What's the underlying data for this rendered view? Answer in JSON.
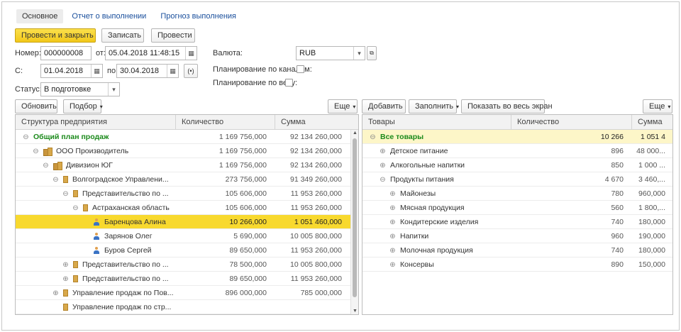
{
  "tabs": [
    {
      "label": "Основное",
      "active": true
    },
    {
      "label": "Отчет о выполнении",
      "active": false
    },
    {
      "label": "Прогноз выполнения",
      "active": false
    }
  ],
  "toolbar": {
    "post_close": "Провести и закрыть",
    "save": "Записать",
    "post": "Провести"
  },
  "form": {
    "number_label": "Номер:",
    "number_value": "000000008",
    "from_label": "от:",
    "from_value": "05.04.2018 11:48:15",
    "start_label": "С:",
    "start_value": "01.04.2018",
    "end_label": "по:",
    "end_value": "30.04.2018",
    "status_label": "Статус:",
    "status_value": "В подготовке",
    "currency_label": "Валюта:",
    "currency_value": "RUB",
    "channels_label": "Планирование по каналам:",
    "weight_label": "Планирование по весу:"
  },
  "left_toolbar": {
    "refresh": "Обновить",
    "pick": "Подбор",
    "more": "Еще"
  },
  "right_toolbar": {
    "add": "Добавить",
    "fill": "Заполнить",
    "fullscreen": "Показать во весь экран",
    "more": "Еще"
  },
  "left_table": {
    "headers": [
      "Структура предприятия",
      "Количество",
      "Сумма"
    ],
    "rows": [
      {
        "name": "Общий план продаж",
        "qty": "1 169 756,000",
        "sum": "92 134 260,000",
        "level": 0,
        "icon": "none",
        "exp": "⊖",
        "green": true
      },
      {
        "name": "ООО Производитель",
        "qty": "1 169 756,000",
        "sum": "92 134 260,000",
        "level": 1,
        "icon": "folder2",
        "exp": "⊖"
      },
      {
        "name": "Дивизион ЮГ",
        "qty": "1 169 756,000",
        "sum": "92 134 260,000",
        "level": 2,
        "icon": "folder2",
        "exp": "⊖"
      },
      {
        "name": "Волгоградское Управлени...",
        "qty": "273 756,000",
        "sum": "91 349 260,000",
        "level": 3,
        "icon": "folder",
        "exp": "⊖"
      },
      {
        "name": "Представительство по ...",
        "qty": "105 606,000",
        "sum": "11 953 260,000",
        "level": 4,
        "icon": "folder",
        "exp": "⊖"
      },
      {
        "name": "Астраханская область",
        "qty": "105 606,000",
        "sum": "11 953 260,000",
        "level": 5,
        "icon": "folder",
        "exp": "⊖"
      },
      {
        "name": "Баренцова Алина",
        "qty": "10 266,000",
        "sum": "1 051 460,000",
        "level": 6,
        "icon": "person",
        "exp": "",
        "selected": true
      },
      {
        "name": "Зарянов Олег",
        "qty": "5 690,000",
        "sum": "10 005 800,000",
        "level": 6,
        "icon": "person",
        "exp": ""
      },
      {
        "name": "Буров Сергей",
        "qty": "89 650,000",
        "sum": "11 953 260,000",
        "level": 6,
        "icon": "person",
        "exp": ""
      },
      {
        "name": "Представительство по ...",
        "qty": "78 500,000",
        "sum": "10 005 800,000",
        "level": 4,
        "icon": "folder",
        "exp": "⊕"
      },
      {
        "name": "Представительство по ...",
        "qty": "89 650,000",
        "sum": "11 953 260,000",
        "level": 4,
        "icon": "folder",
        "exp": "⊕"
      },
      {
        "name": "Управление продаж по Пов...",
        "qty": "896 000,000",
        "sum": "785 000,000",
        "level": 3,
        "icon": "folder",
        "exp": "⊕"
      },
      {
        "name": "Управление продаж по стр...",
        "qty": "",
        "sum": "",
        "level": 3,
        "icon": "folder",
        "exp": ""
      }
    ]
  },
  "right_table": {
    "headers": [
      "Товары",
      "Количество",
      "Сумма"
    ],
    "rows": [
      {
        "name": "Все товары",
        "qty": "10 266",
        "sum": "1 051 4",
        "level": 0,
        "exp": "⊖",
        "green": true,
        "highlight": true
      },
      {
        "name": "Детское питание",
        "qty": "896",
        "sum": "48 000...",
        "level": 1,
        "exp": "⊕"
      },
      {
        "name": "Алкогольные напитки",
        "qty": "850",
        "sum": "1 000 ...",
        "level": 1,
        "exp": "⊕"
      },
      {
        "name": "Продукты питания",
        "qty": "4 670",
        "sum": "3 460,...",
        "level": 1,
        "exp": "⊖"
      },
      {
        "name": "Майонезы",
        "qty": "780",
        "sum": "960,000",
        "level": 2,
        "exp": "⊕"
      },
      {
        "name": "Мясная продукция",
        "qty": "560",
        "sum": "1 800,...",
        "level": 2,
        "exp": "⊕"
      },
      {
        "name": "Кондитерские изделия",
        "qty": "740",
        "sum": "180,000",
        "level": 2,
        "exp": "⊕"
      },
      {
        "name": "Напитки",
        "qty": "960",
        "sum": "190,000",
        "level": 2,
        "exp": "⊕"
      },
      {
        "name": "Молочная продукция",
        "qty": "740",
        "sum": "180,000",
        "level": 2,
        "exp": "⊕"
      },
      {
        "name": "Консервы",
        "qty": "890",
        "sum": "150,000",
        "level": 2,
        "exp": "⊕"
      }
    ]
  }
}
